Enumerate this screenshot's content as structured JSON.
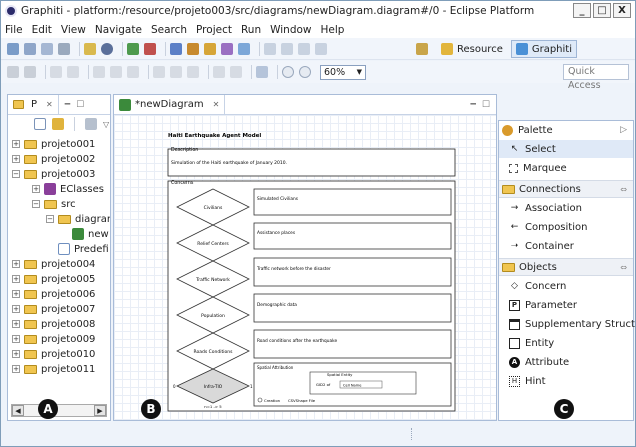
{
  "window": {
    "title": "Graphiti - platform:/resource/projeto003/src/diagrams/newDiagram.diagram#/0 - Eclipse Platform",
    "min": "_",
    "max": "□",
    "close": "X"
  },
  "menu": [
    "File",
    "Edit",
    "View",
    "Navigate",
    "Search",
    "Project",
    "Run",
    "Window",
    "Help"
  ],
  "toolbar": {
    "zoom": "60%",
    "quick_access_placeholder": "Quick Access"
  },
  "perspectives": {
    "resource": "Resource",
    "graphiti": "Graphiti"
  },
  "explorer": {
    "tab_label": "P",
    "tab_close": "✕",
    "items": [
      {
        "label": "projeto001",
        "expander": "+"
      },
      {
        "label": "projeto002",
        "expander": "+"
      },
      {
        "label": "projeto003",
        "expander": "−"
      },
      {
        "label": "EClasses",
        "expander": "+"
      },
      {
        "label": "src",
        "expander": "−"
      },
      {
        "label": "diagrar",
        "expander": "−"
      },
      {
        "label": "new",
        "expander": ""
      },
      {
        "label": "Predefi",
        "expander": ""
      },
      {
        "label": "projeto004",
        "expander": "+"
      },
      {
        "label": "projeto005",
        "expander": "+"
      },
      {
        "label": "projeto006",
        "expander": "+"
      },
      {
        "label": "projeto007",
        "expander": "+"
      },
      {
        "label": "projeto008",
        "expander": "+"
      },
      {
        "label": "projeto009",
        "expander": "+"
      },
      {
        "label": "projeto010",
        "expander": "+"
      },
      {
        "label": "projeto011",
        "expander": "+"
      }
    ]
  },
  "editor": {
    "tab_label": "*newDiagram",
    "tab_close": "✕",
    "tab_icon_text": "Diagram"
  },
  "diagram": {
    "title": "Haiti Earthquake Agent Model",
    "description_label": "Description",
    "description_text": "Simulation of the Haiti earthquake of January 2010.",
    "concerns_label": "Concerns",
    "concerns": [
      {
        "name": "Civilians",
        "text": "Simulated Civilians"
      },
      {
        "name": "Relief Centers",
        "text": "Assistance places"
      },
      {
        "name": "Traffic Network",
        "text": "Traffic network before the disaster"
      },
      {
        "name": "Population",
        "text": "Demographic data"
      },
      {
        "name": "Roads Conditions",
        "text": "Road conditions after the earthquake"
      }
    ],
    "last_diamond": {
      "name": "Infra-TIO",
      "left": "0",
      "right": "1",
      "bottom": "n=1 -> 5"
    },
    "spatial": {
      "header": "Spatial Attribution",
      "entity_label": "Spatial Entity",
      "gid_label": "GID2 of",
      "field_value": "Cell Name",
      "creation_label": "Creation",
      "shape_label": "CSVShape File"
    }
  },
  "palette": {
    "title": "Palette",
    "tools": [
      {
        "label": "Select"
      },
      {
        "label": "Marquee"
      }
    ],
    "connections_label": "Connections",
    "connections": [
      {
        "label": "Association"
      },
      {
        "label": "Composition"
      },
      {
        "label": "Container"
      }
    ],
    "objects_label": "Objects",
    "objects": [
      {
        "label": "Concern"
      },
      {
        "label": "Parameter"
      },
      {
        "label": "Supplementary Structure"
      },
      {
        "label": "Entity"
      },
      {
        "label": "Attribute"
      },
      {
        "label": "Hint"
      }
    ]
  },
  "badges": {
    "a": "A",
    "b": "B",
    "c": "C"
  }
}
